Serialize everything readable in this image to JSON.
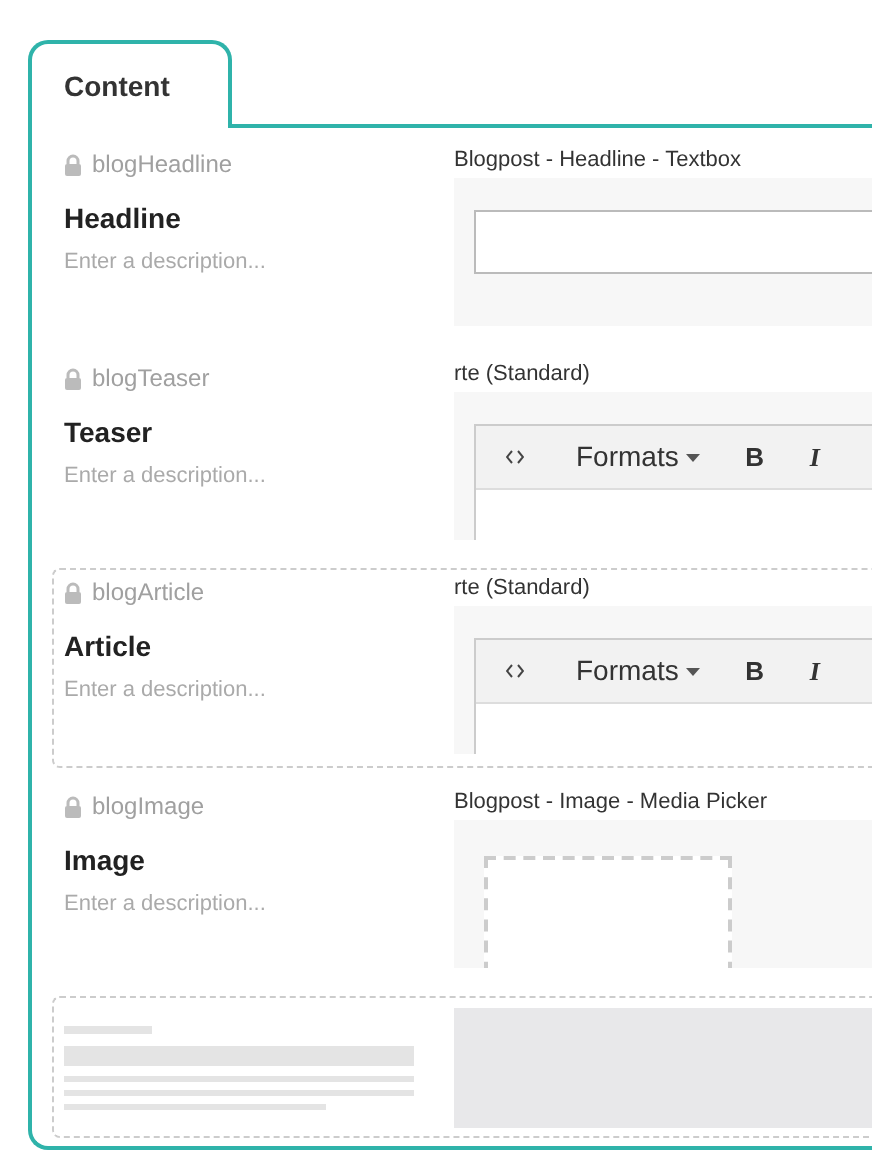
{
  "tab": {
    "label": "Content",
    "selected": true
  },
  "properties": [
    {
      "alias": "blogHeadline",
      "name": "Headline",
      "description_placeholder": "Enter a description...",
      "editor": "Blogpost - Headline - Textbox",
      "kind": "textbox",
      "selected": false
    },
    {
      "alias": "blogTeaser",
      "name": "Teaser",
      "description_placeholder": "Enter a description...",
      "editor": "rte (Standard)",
      "kind": "rte",
      "selected": false,
      "toolbar": {
        "formats": "Formats",
        "bold": "B",
        "italic": "I"
      }
    },
    {
      "alias": "blogArticle",
      "name": "Article",
      "description_placeholder": "Enter a description...",
      "editor": "rte (Standard)",
      "kind": "rte",
      "selected": true,
      "toolbar": {
        "formats": "Formats",
        "bold": "B",
        "italic": "I"
      }
    },
    {
      "alias": "blogImage",
      "name": "Image",
      "description_placeholder": "Enter a description...",
      "editor": "Blogpost - Image - Media Picker",
      "kind": "media",
      "selected": false
    }
  ]
}
